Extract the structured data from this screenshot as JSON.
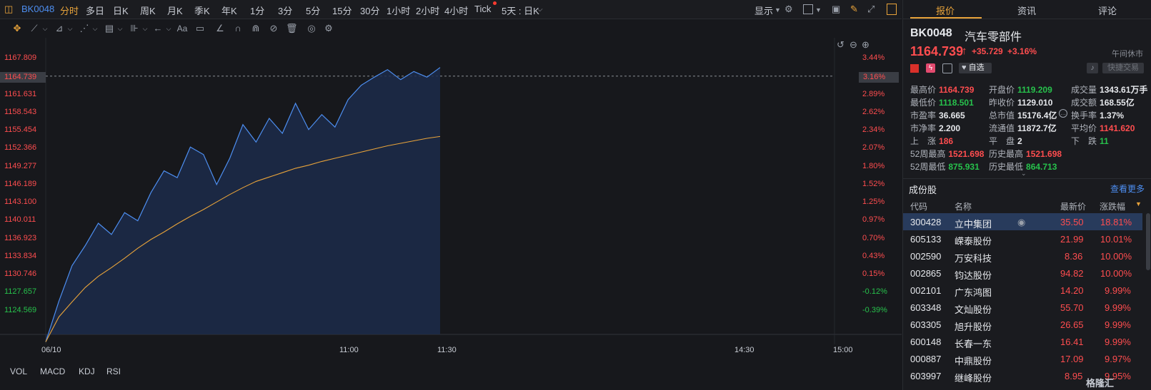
{
  "topbar": {
    "code": "BK0048",
    "periods": [
      "分时",
      "多日",
      "日K",
      "周K",
      "月K",
      "季K",
      "年K",
      "1分",
      "3分",
      "5分",
      "15分",
      "30分",
      "1小时",
      "2小时",
      "4小时",
      "Tick"
    ],
    "period_extra": "5天 : 日K",
    "display_label": "显示",
    "active_period": "分时"
  },
  "chart": {
    "price_ticks": [
      "1167.809",
      "1164.739",
      "1161.631",
      "1158.543",
      "1155.454",
      "1152.366",
      "1149.277",
      "1146.189",
      "1143.100",
      "1140.011",
      "1136.923",
      "1133.834",
      "1130.746",
      "1127.657",
      "1124.569"
    ],
    "pct_ticks": [
      "3.44%",
      "3.16%",
      "2.89%",
      "2.62%",
      "2.34%",
      "2.07%",
      "1.80%",
      "1.52%",
      "1.25%",
      "0.97%",
      "0.70%",
      "0.43%",
      "0.15%",
      "-0.12%",
      "-0.39%"
    ],
    "x_ticks": [
      "06/10",
      "11:00",
      "11:30",
      "14:30",
      "15:00"
    ],
    "current_price_tag": "1164.739",
    "current_pct_tag": "3.16%",
    "indicators": [
      "VOL",
      "MACD",
      "KDJ",
      "RSI"
    ]
  },
  "chart_data": {
    "type": "line",
    "ylim": [
      1122.0,
      1169.5
    ],
    "series": [
      {
        "values": [
          1120.8,
          1127.3,
          1133.0,
          1136.2,
          1139.8,
          1138.0,
          1141.5,
          1140.2,
          1144.7,
          1148.2,
          1147.1,
          1152.0,
          1150.8,
          1146.0,
          1150.2,
          1155.6,
          1152.8,
          1156.6,
          1154.2,
          1159.0,
          1154.8,
          1157.2,
          1155.2,
          1159.6,
          1161.9,
          1163.2,
          1164.4,
          1162.8,
          1164.1,
          1163.2,
          1164.74
        ]
      },
      {
        "values": [
          1120.8,
          1124.8,
          1127.2,
          1129.5,
          1131.3,
          1132.7,
          1134.2,
          1135.8,
          1137.2,
          1138.4,
          1139.7,
          1140.9,
          1142.0,
          1143.2,
          1144.4,
          1145.5,
          1146.5,
          1147.2,
          1147.9,
          1148.6,
          1149.1,
          1149.7,
          1150.2,
          1150.7,
          1151.2,
          1151.7,
          1152.2,
          1152.6,
          1153.0,
          1153.4,
          1153.7
        ]
      }
    ]
  },
  "panel": {
    "tabs": [
      "报价",
      "资讯",
      "评论"
    ],
    "code": "BK0048",
    "name": "汽车零部件",
    "price": "1164.739",
    "change": "+35.729",
    "change_pct": "+3.16%",
    "status": "午间休市",
    "watch_label": "自选",
    "quick_trade": "快捷交易",
    "stats": [
      {
        "label": "最高价",
        "value": "1164.739",
        "color": "red"
      },
      {
        "label": "开盘价",
        "value": "1119.209",
        "color": "green"
      },
      {
        "label": "成交量",
        "value": "1343.61万手",
        "color": "white"
      },
      {
        "label": "最低价",
        "value": "1118.501",
        "color": "green"
      },
      {
        "label": "昨收价",
        "value": "1129.010",
        "color": "white"
      },
      {
        "label": "成交额",
        "value": "168.55亿",
        "color": "white"
      },
      {
        "label": "市盈率",
        "value": "36.665",
        "color": "white"
      },
      {
        "label": "总市值",
        "value": "15176.4亿",
        "color": "white"
      },
      {
        "label": "换手率",
        "value": "1.37%",
        "color": "white"
      },
      {
        "label": "市净率",
        "value": "2.200",
        "color": "white"
      },
      {
        "label": "流通值",
        "value": "11872.7亿",
        "color": "white"
      },
      {
        "label": "平均价",
        "value": "1141.620",
        "color": "red"
      },
      {
        "label": "上　涨",
        "value": "186",
        "color": "red"
      },
      {
        "label": "平　盘",
        "value": "2",
        "color": "white"
      },
      {
        "label": "下　跌",
        "value": "11",
        "color": "green"
      },
      {
        "label": "52周最高",
        "value": "1521.698",
        "color": "red"
      },
      {
        "label": "历史最高",
        "value": "1521.698",
        "color": "red"
      },
      {
        "label": "52周最低",
        "value": "875.931",
        "color": "green"
      },
      {
        "label": "历史最低",
        "value": "864.713",
        "color": "green"
      }
    ],
    "constituents_title": "成份股",
    "see_more": "查看更多",
    "table_headers": [
      "代码",
      "名称",
      "最新价",
      "涨跌幅"
    ],
    "rows": [
      {
        "code": "300428",
        "name": "立中集团",
        "price": "35.50",
        "pct": "18.81%"
      },
      {
        "code": "605133",
        "name": "嵘泰股份",
        "price": "21.99",
        "pct": "10.01%"
      },
      {
        "code": "002590",
        "name": "万安科技",
        "price": "8.36",
        "pct": "10.00%"
      },
      {
        "code": "002865",
        "name": "钧达股份",
        "price": "94.82",
        "pct": "10.00%"
      },
      {
        "code": "002101",
        "name": "广东鸿图",
        "price": "14.20",
        "pct": "9.99%"
      },
      {
        "code": "603348",
        "name": "文灿股份",
        "price": "55.70",
        "pct": "9.99%"
      },
      {
        "code": "603305",
        "name": "旭升股份",
        "price": "26.65",
        "pct": "9.99%"
      },
      {
        "code": "600148",
        "name": "长春一东",
        "price": "16.41",
        "pct": "9.99%"
      },
      {
        "code": "000887",
        "name": "中鼎股份",
        "price": "17.09",
        "pct": "9.97%"
      },
      {
        "code": "603997",
        "name": "继峰股份",
        "price": "8.95",
        "pct": "9.95%"
      }
    ],
    "watermark": "格隆汇"
  },
  "colors": {
    "accent": "#e8a33a",
    "up": "#ff4d4f",
    "down": "#27c24c",
    "line": "#4d8ef0",
    "avg": "#e8a33a"
  }
}
